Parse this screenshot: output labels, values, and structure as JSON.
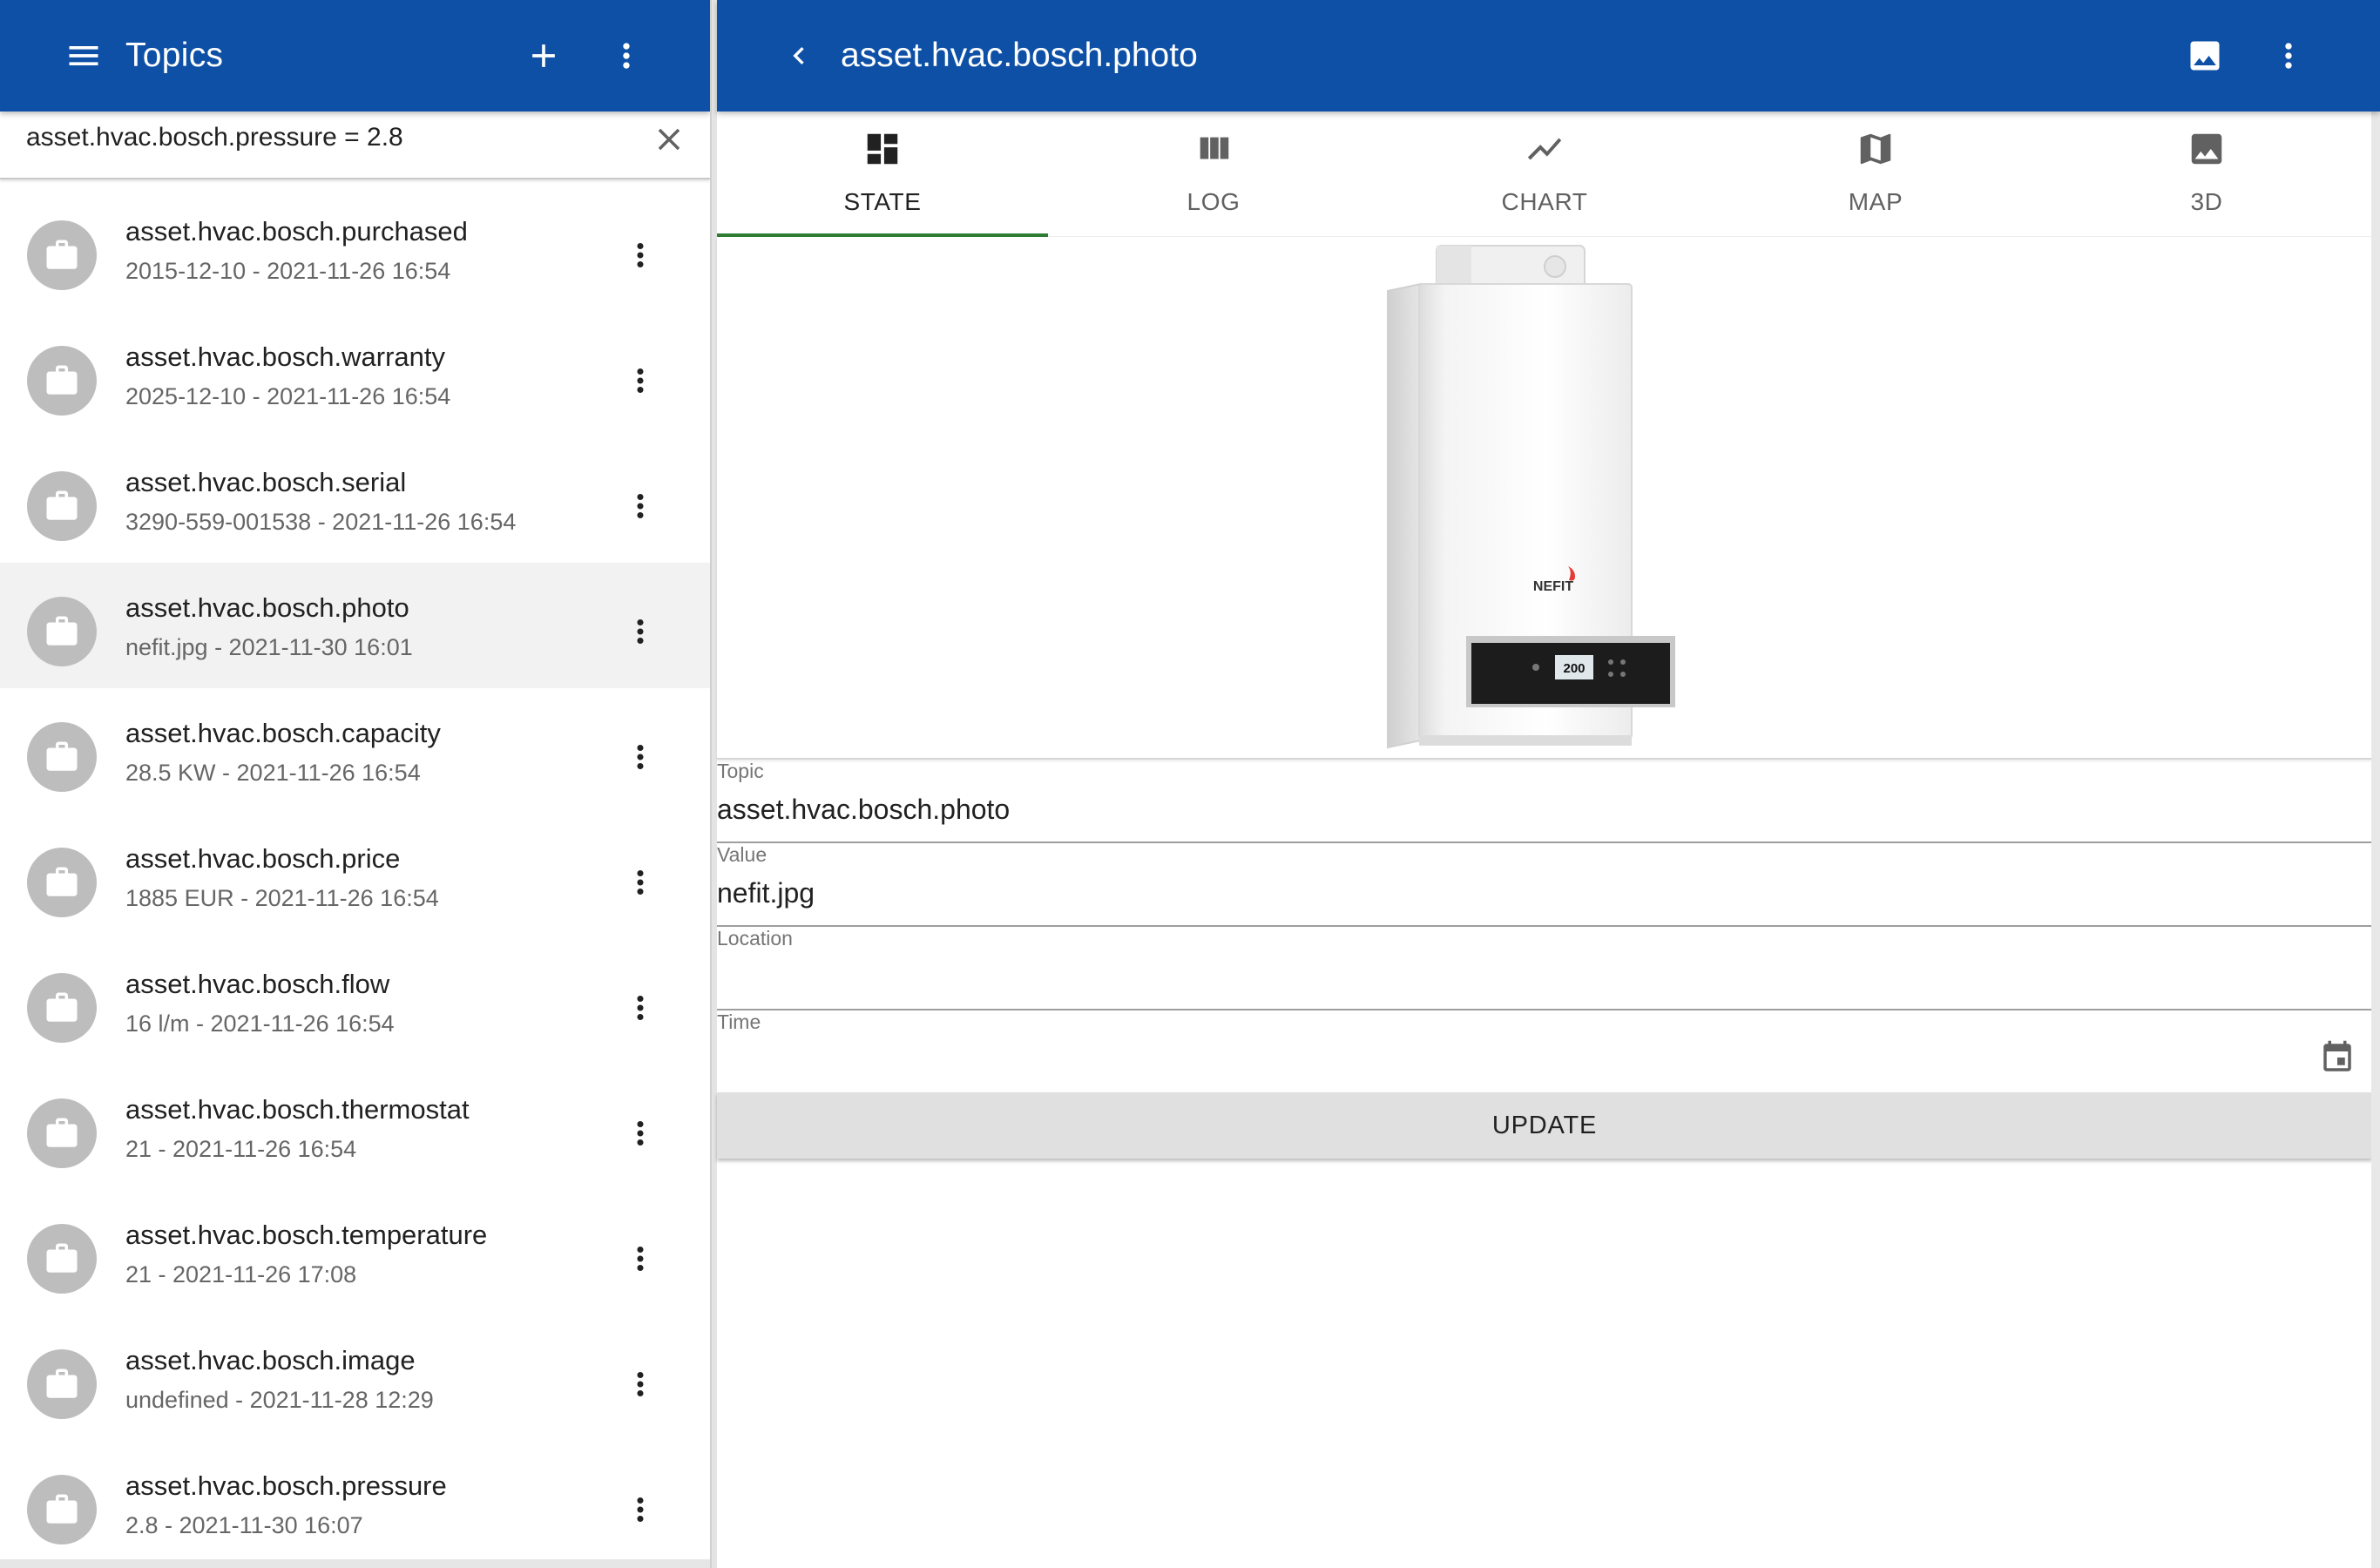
{
  "left": {
    "title": "Topics",
    "search": {
      "value": "asset.hvac.bosch.pressure = 2.8",
      "placeholder": ""
    },
    "topics": [
      {
        "name": "asset.hvac.bosch.purchased",
        "subtitle": "2015-12-10 - 2021-11-26 16:54"
      },
      {
        "name": "asset.hvac.bosch.warranty",
        "subtitle": "2025-12-10 - 2021-11-26 16:54"
      },
      {
        "name": "asset.hvac.bosch.serial",
        "subtitle": "3290-559-001538 - 2021-11-26 16:54"
      },
      {
        "name": "asset.hvac.bosch.photo",
        "subtitle": "nefit.jpg - 2021-11-30 16:01",
        "selected": true
      },
      {
        "name": "asset.hvac.bosch.capacity",
        "subtitle": "28.5 KW - 2021-11-26 16:54"
      },
      {
        "name": "asset.hvac.bosch.price",
        "subtitle": "1885 EUR - 2021-11-26 16:54"
      },
      {
        "name": "asset.hvac.bosch.flow",
        "subtitle": "16 l/m - 2021-11-26 16:54"
      },
      {
        "name": "asset.hvac.bosch.thermostat",
        "subtitle": "21 - 2021-11-26 16:54"
      },
      {
        "name": "asset.hvac.bosch.temperature",
        "subtitle": "21 - 2021-11-26 17:08"
      },
      {
        "name": "asset.hvac.bosch.image",
        "subtitle": "undefined - 2021-11-28 12:29"
      },
      {
        "name": "asset.hvac.bosch.pressure",
        "subtitle": "2.8 - 2021-11-30 16:07"
      }
    ]
  },
  "right": {
    "title": "asset.hvac.bosch.photo",
    "tabs": [
      {
        "label": "STATE",
        "icon": "dashboard-icon",
        "active": true
      },
      {
        "label": "LOG",
        "icon": "view-column-icon"
      },
      {
        "label": "CHART",
        "icon": "show-chart-icon"
      },
      {
        "label": "MAP",
        "icon": "map-icon"
      },
      {
        "label": "3D",
        "icon": "image-icon"
      }
    ],
    "photo": {
      "brand": "NEFIT",
      "display": "200"
    },
    "fields": {
      "topic": {
        "label": "Topic",
        "value": "asset.hvac.bosch.photo"
      },
      "value": {
        "label": "Value",
        "value": "nefit.jpg"
      },
      "location": {
        "label": "Location",
        "value": ""
      },
      "time": {
        "label": "Time",
        "value": ""
      }
    },
    "update_label": "UPDATE"
  },
  "colors": {
    "appbar": "#0d50a6",
    "tab_indicator": "#2e7d32",
    "avatar": "#bdbdbd",
    "selected_row": "#f2f2f2",
    "update_button": "#e0e0e0"
  }
}
